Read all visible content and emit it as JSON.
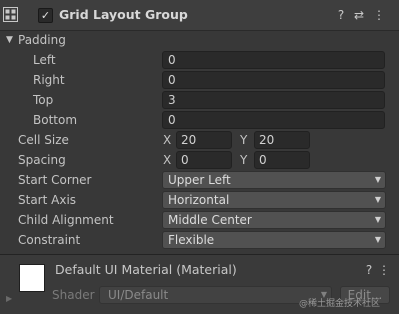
{
  "component": {
    "title": "Grid Layout Group",
    "enabled_check": "✓",
    "help_glyph": "?",
    "presets_glyph": "⇄",
    "menu_glyph": "⋮"
  },
  "padding": {
    "label": "Padding",
    "foldout_glyph": "▼",
    "left": {
      "label": "Left",
      "value": "0"
    },
    "right": {
      "label": "Right",
      "value": "0"
    },
    "top": {
      "label": "Top",
      "value": "3"
    },
    "bottom": {
      "label": "Bottom",
      "value": "0"
    }
  },
  "cell_size": {
    "label": "Cell Size",
    "x_label": "X",
    "x_value": "20",
    "y_label": "Y",
    "y_value": "20"
  },
  "spacing": {
    "label": "Spacing",
    "x_label": "X",
    "x_value": "0",
    "y_label": "Y",
    "y_value": "0"
  },
  "start_corner": {
    "label": "Start Corner",
    "value": "Upper Left"
  },
  "start_axis": {
    "label": "Start Axis",
    "value": "Horizontal"
  },
  "child_alignment": {
    "label": "Child Alignment",
    "value": "Middle Center"
  },
  "constraint": {
    "label": "Constraint",
    "value": "Flexible"
  },
  "dropdown_glyph": "▼",
  "material": {
    "title": "Default UI Material (Material)",
    "help_glyph": "?",
    "menu_glyph": "⋮",
    "shader_label": "Shader",
    "shader_value": "UI/Default",
    "edit_label": "Edit...",
    "expand_glyph": "▶"
  },
  "watermark": "@稀土掘金技术社区",
  "icons": {
    "component": "grid-layout-icon",
    "checkbox": "checkbox-icon",
    "help": "help-icon",
    "presets": "presets-icon",
    "menu": "kebab-menu-icon"
  }
}
